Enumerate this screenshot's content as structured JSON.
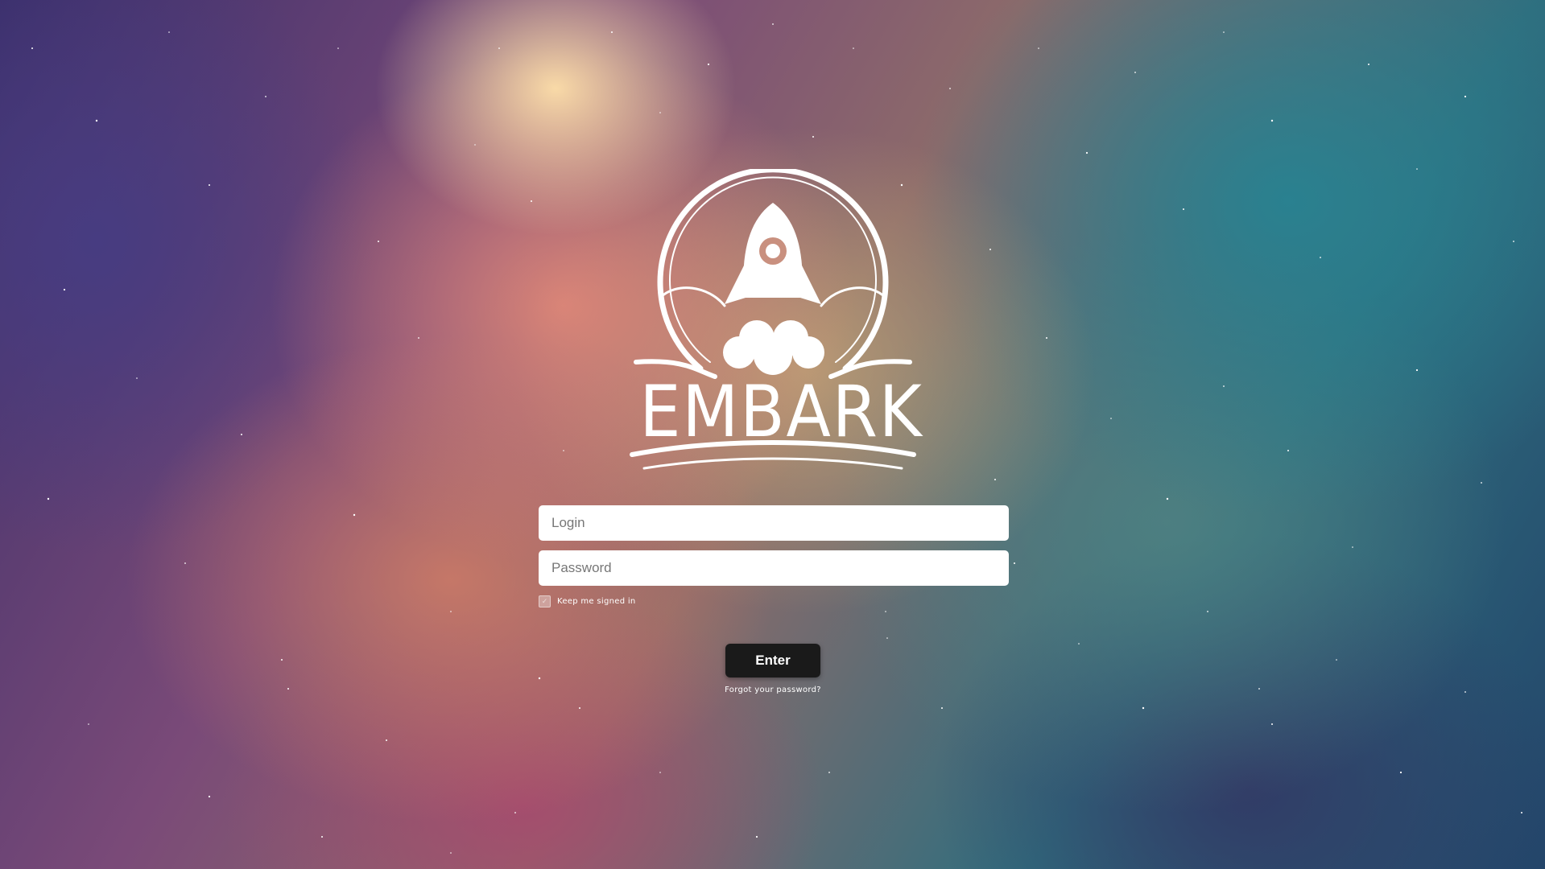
{
  "brand": {
    "name": "EMBARK",
    "logo_icon": "rocket-icon"
  },
  "form": {
    "login_placeholder": "Login",
    "login_value": "",
    "password_placeholder": "Password",
    "password_value": "",
    "remember_label": "Keep me signed in",
    "remember_checked": false,
    "submit_label": "Enter",
    "forgot_label": "Forgot your password?"
  },
  "colors": {
    "button_bg": "#1a1a1a",
    "button_text": "#ffffff",
    "field_bg": "#ffffff"
  }
}
